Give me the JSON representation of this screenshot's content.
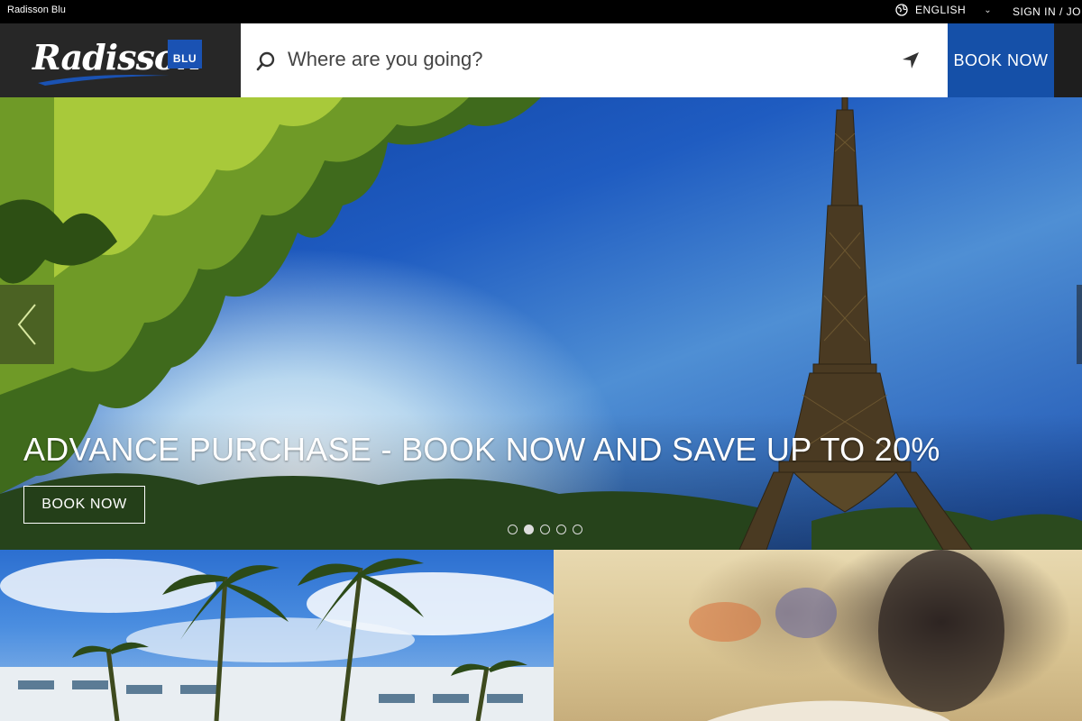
{
  "topbar": {
    "brand": "Radisson Blu",
    "language": "ENGLISH",
    "signin": "SIGN IN / JOI"
  },
  "header": {
    "logo_text": "Radisson",
    "logo_badge": "BLU",
    "search_placeholder": "Where are you going?",
    "book_button": "BOOK NOW"
  },
  "hero": {
    "headline": "ADVANCE PURCHASE - BOOK NOW AND SAVE UP TO 20%",
    "cta": "BOOK NOW",
    "slides_count": 5,
    "active_slide": 2
  },
  "colors": {
    "accent": "#1550a8",
    "topbar": "#000000",
    "header": "#222222"
  }
}
